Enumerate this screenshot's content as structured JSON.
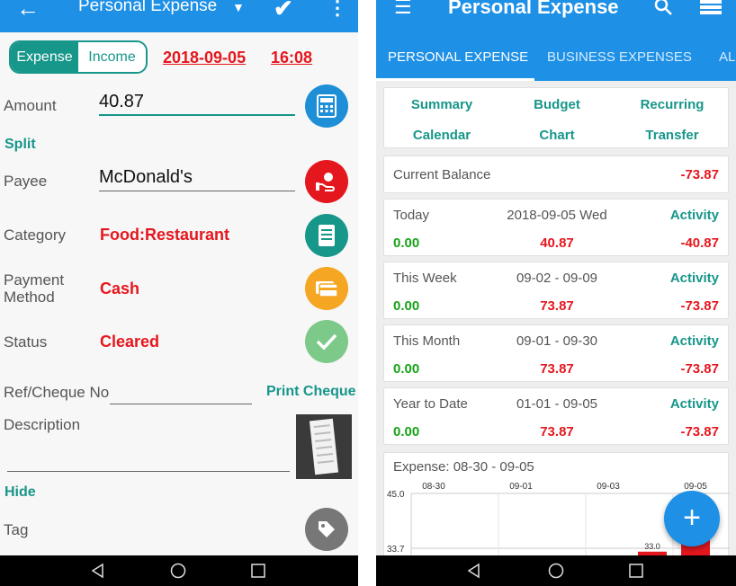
{
  "left": {
    "appbar": {
      "title": "Personal Expense",
      "back_icon": "←",
      "dropdown_icon": "▼",
      "confirm_icon": "✔",
      "more_icon": "⋮"
    },
    "toggle": {
      "expense": "Expense",
      "income": "Income"
    },
    "date": "2018-09-05",
    "time": "16:08",
    "amount": {
      "label": "Amount",
      "value": "40.87"
    },
    "split": "Split",
    "payee": {
      "label": "Payee",
      "value": "McDonald's"
    },
    "category": {
      "label": "Category",
      "value": "Food:Restaurant"
    },
    "payment": {
      "label_line1": "Payment",
      "label_line2": "Method",
      "value": "Cash"
    },
    "status": {
      "label": "Status",
      "value": "Cleared"
    },
    "ref": {
      "label": "Ref/Cheque No",
      "value": "",
      "print": "Print Cheque"
    },
    "description": {
      "label": "Description",
      "value": ""
    },
    "hide": "Hide",
    "tag": {
      "label": "Tag"
    },
    "colors": {
      "primary": "#1e90e6",
      "teal": "#17968a",
      "red": "#e5171e",
      "calc": "#1e8fd6",
      "payee": "#e5171e",
      "category": "#17968a",
      "payment": "#f5a623",
      "status": "#7dc98a",
      "tag": "#777777"
    }
  },
  "right": {
    "appbar": {
      "title": "Personal Expense"
    },
    "tabs": [
      "PERSONAL EXPENSE",
      "BUSINESS EXPENSES",
      "AL"
    ],
    "links": [
      "Summary",
      "Budget",
      "Recurring",
      "Calendar",
      "Chart",
      "Transfer"
    ],
    "balance": {
      "label": "Current Balance",
      "value": "-73.87"
    },
    "periods": [
      {
        "label": "Today",
        "date": "2018-09-05 Wed",
        "activity": "Activity",
        "income": "0.00",
        "expense": "40.87",
        "net": "-40.87"
      },
      {
        "label": "This Week",
        "date": "09-02 - 09-09",
        "activity": "Activity",
        "income": "0.00",
        "expense": "73.87",
        "net": "-73.87"
      },
      {
        "label": "This Month",
        "date": "09-01 - 09-30",
        "activity": "Activity",
        "income": "0.00",
        "expense": "73.87",
        "net": "-73.87"
      },
      {
        "label": "Year to Date",
        "date": "01-01 - 09-05",
        "activity": "Activity",
        "income": "0.00",
        "expense": "73.87",
        "net": "-73.87"
      }
    ],
    "chart_title": "Expense: 08-30 - 09-05",
    "fab": "+"
  },
  "chart_data": {
    "type": "bar",
    "title": "Expense: 08-30 - 09-05",
    "categories": [
      "08-30",
      "09-01",
      "09-03",
      "09-05"
    ],
    "ytick_labels": [
      "45.0",
      "33.7"
    ],
    "data_labels": [
      "33.0"
    ],
    "series": [
      {
        "values": [
          0,
          0,
          33.0,
          40.87
        ]
      }
    ]
  }
}
